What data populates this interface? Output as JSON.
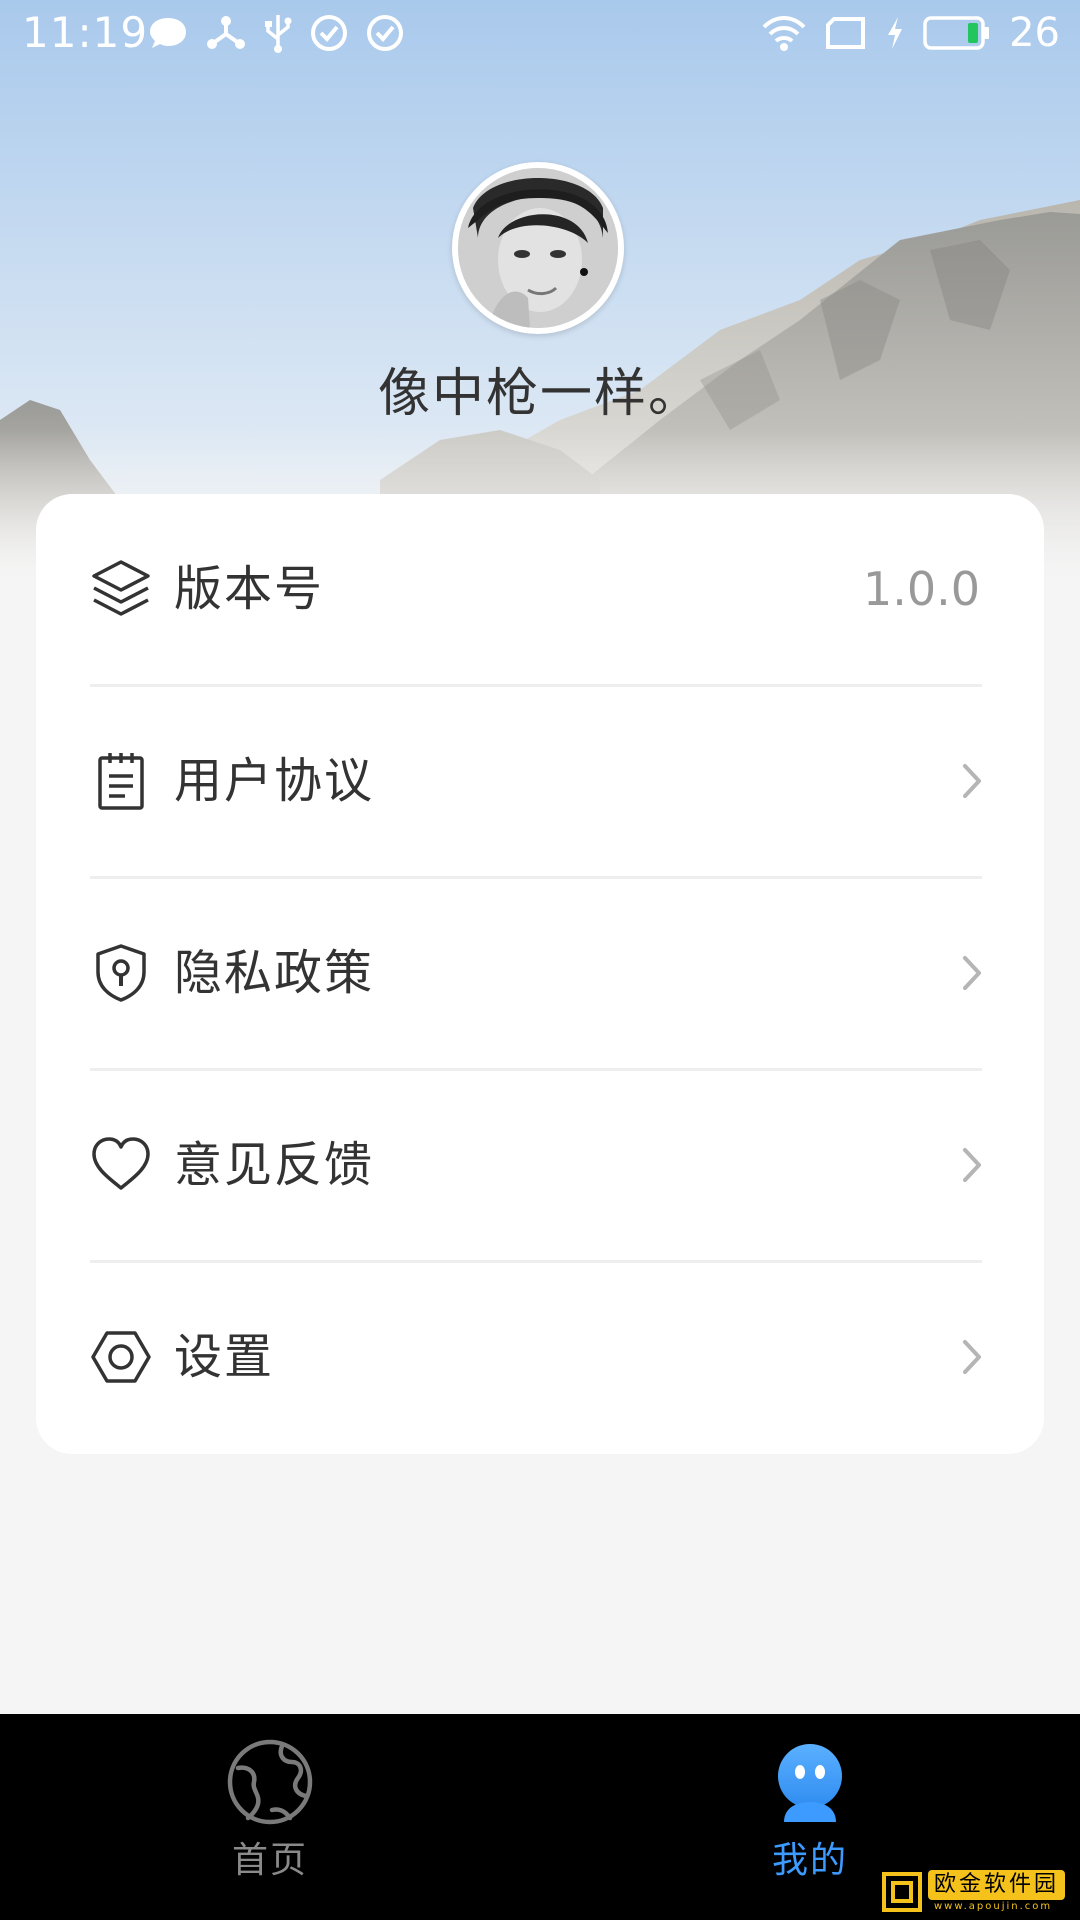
{
  "status_bar": {
    "time": "11:19",
    "battery_percent": "26",
    "left_icons": [
      "chat-bubble-icon",
      "share-network-icon",
      "usb-icon",
      "check-circle-icon",
      "check-circle-icon"
    ],
    "right_icons": [
      "wifi-icon",
      "sim-card-icon",
      "charging-bolt-icon",
      "battery-icon"
    ],
    "battery_color": "#22c55e"
  },
  "profile": {
    "username": "像中枪一样。"
  },
  "menu": {
    "items": [
      {
        "label": "版本号",
        "value": "1.0.0",
        "icon": "layers-icon",
        "has_chevron": false
      },
      {
        "label": "用户协议",
        "icon": "document-icon",
        "has_chevron": true
      },
      {
        "label": "隐私政策",
        "icon": "shield-keyhole-icon",
        "has_chevron": true
      },
      {
        "label": "意见反馈",
        "icon": "heart-icon",
        "has_chevron": true
      },
      {
        "label": "设置",
        "icon": "hexagon-settings-icon",
        "has_chevron": true
      }
    ]
  },
  "bottom_nav": {
    "tabs": [
      {
        "label": "首页",
        "icon": "globe-icon",
        "active": false
      },
      {
        "label": "我的",
        "icon": "user-avatar-icon",
        "active": true
      }
    ],
    "active_color": "#3d9bff",
    "inactive_color": "#8a8a8a"
  },
  "watermark": {
    "text": "欧金软件园",
    "subtext": "www.apoujin.com"
  },
  "colors": {
    "page_background": "#f5f5f5",
    "card_background": "#ffffff",
    "text_primary": "#333333",
    "text_secondary": "#999999",
    "nav_background": "#000000"
  }
}
